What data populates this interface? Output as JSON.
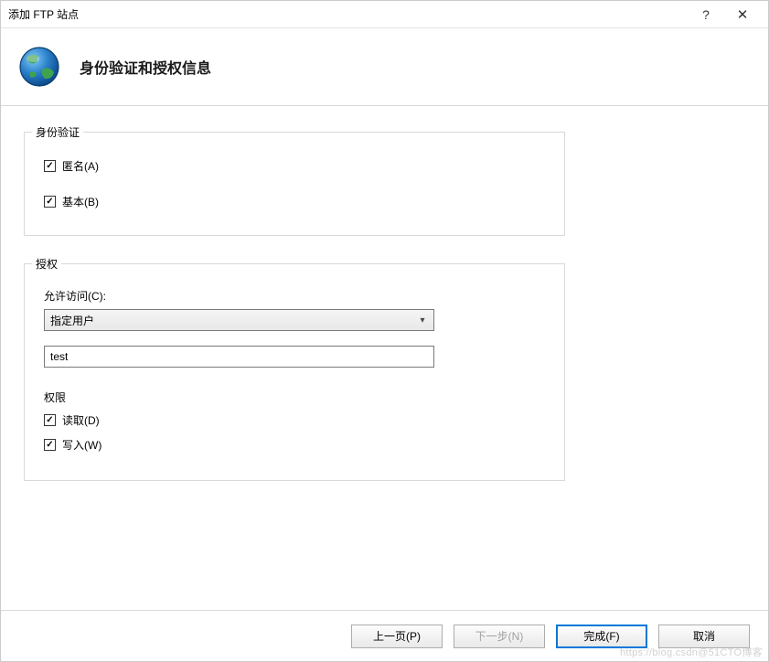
{
  "window": {
    "title": "添加 FTP 站点",
    "help_symbol": "?",
    "close_symbol": "✕"
  },
  "header": {
    "title": "身份验证和授权信息"
  },
  "groups": {
    "auth": {
      "legend": "身份验证",
      "anonymous_label": "匿名(A)",
      "basic_label": "基本(B)"
    },
    "authz": {
      "legend": "授权",
      "allow_access_label": "允许访问(C):",
      "allow_access_selected": "指定用户",
      "user_value": "test",
      "permissions_label": "权限",
      "read_label": "读取(D)",
      "write_label": "写入(W)"
    }
  },
  "footer": {
    "prev": "上一页(P)",
    "next": "下一步(N)",
    "finish": "完成(F)",
    "cancel": "取消"
  },
  "watermark": "https://blog.csdn@51CTO博客"
}
